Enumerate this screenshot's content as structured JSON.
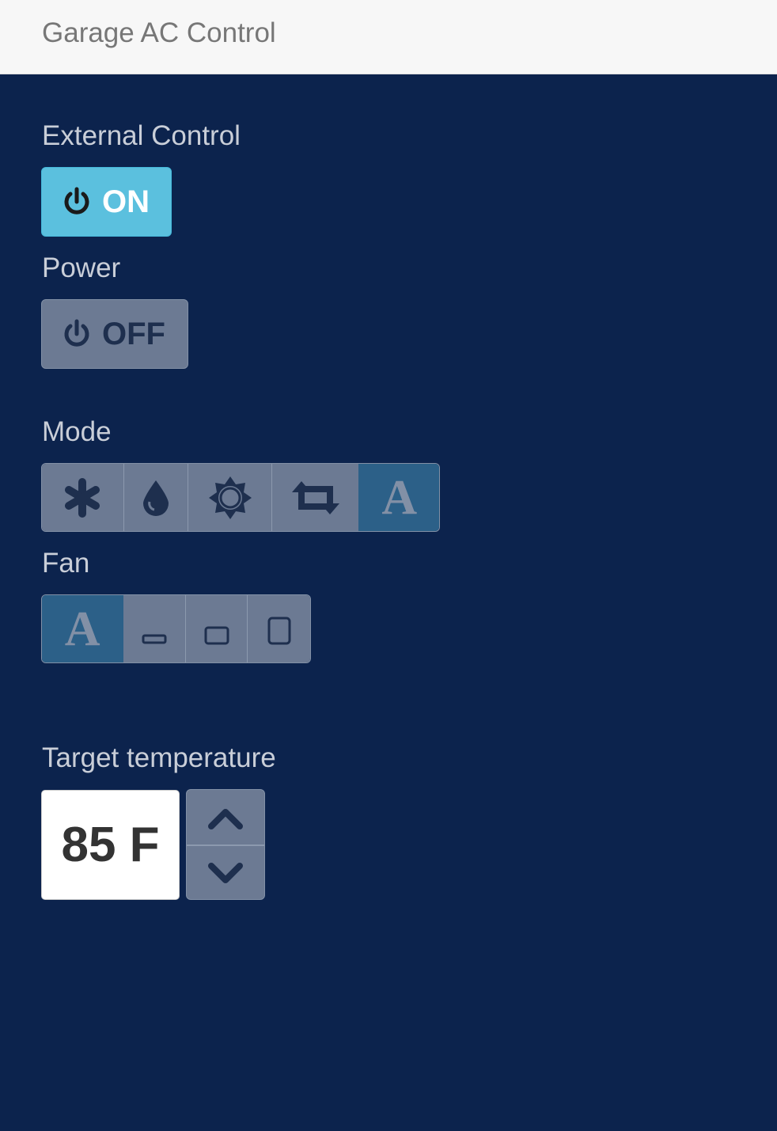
{
  "navbar": {
    "title": "Garage AC Control"
  },
  "external_control": {
    "label": "External Control",
    "state": "ON",
    "color": "#5bc0de"
  },
  "power": {
    "label": "Power",
    "state": "OFF"
  },
  "mode": {
    "label": "Mode",
    "options": [
      {
        "id": "cool",
        "icon": "snowflake-asterisk-icon"
      },
      {
        "id": "dry",
        "icon": "water-drop-icon"
      },
      {
        "id": "heat",
        "icon": "sun-icon"
      },
      {
        "id": "fan",
        "icon": "retweet-cycle-icon"
      },
      {
        "id": "auto",
        "icon": "letter-a-icon",
        "text": "A"
      }
    ],
    "selected": "auto"
  },
  "fan": {
    "label": "Fan",
    "options": [
      {
        "id": "auto",
        "icon": "letter-a-icon",
        "text": "A"
      },
      {
        "id": "low",
        "icon": "fan-low-icon"
      },
      {
        "id": "medium",
        "icon": "fan-medium-icon"
      },
      {
        "id": "high",
        "icon": "fan-high-icon"
      }
    ],
    "selected": "auto"
  },
  "target_temperature": {
    "label": "Target temperature",
    "value": "85 F"
  },
  "colors": {
    "background": "#0c234d",
    "active_segment": "#2c6088",
    "inactive_segment": "#6c7a93",
    "icon": "#1e2f4e"
  }
}
